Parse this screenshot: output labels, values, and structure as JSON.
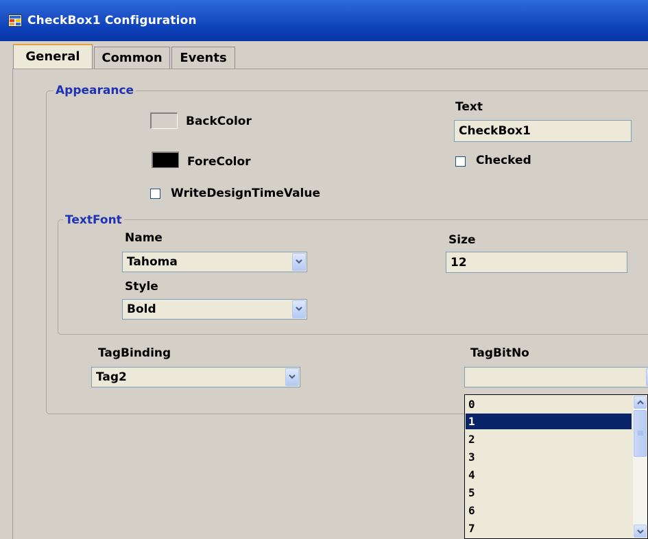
{
  "window": {
    "title": "CheckBox1 Configuration",
    "accent": "#0a36a6",
    "title_icon": "app-window-icon"
  },
  "tabs": [
    {
      "label": "General",
      "active": true
    },
    {
      "label": "Common",
      "active": false
    },
    {
      "label": "Events",
      "active": false
    }
  ],
  "appearance": {
    "legend": "Appearance",
    "back_color_label": "BackColor",
    "back_color_value": "#d4d0c8",
    "fore_color_label": "ForeColor",
    "fore_color_value": "#000000",
    "write_design_label": "WriteDesignTimeValue",
    "write_design_checked": false,
    "text_label": "Text",
    "text_value": "CheckBox1",
    "checked_label": "Checked",
    "checked_value": false
  },
  "textfont": {
    "legend": "TextFont",
    "name_label": "Name",
    "name_value": "Tahoma",
    "size_label": "Size",
    "size_value": "12",
    "style_label": "Style",
    "style_value": "Bold"
  },
  "tag": {
    "binding_label": "TagBinding",
    "binding_value": "Tag2",
    "bitno_label": "TagBitNo",
    "bitno_value": "",
    "bitno_options": [
      "0",
      "1",
      "2",
      "3",
      "4",
      "5",
      "6",
      "7"
    ],
    "bitno_highlighted": "1"
  }
}
